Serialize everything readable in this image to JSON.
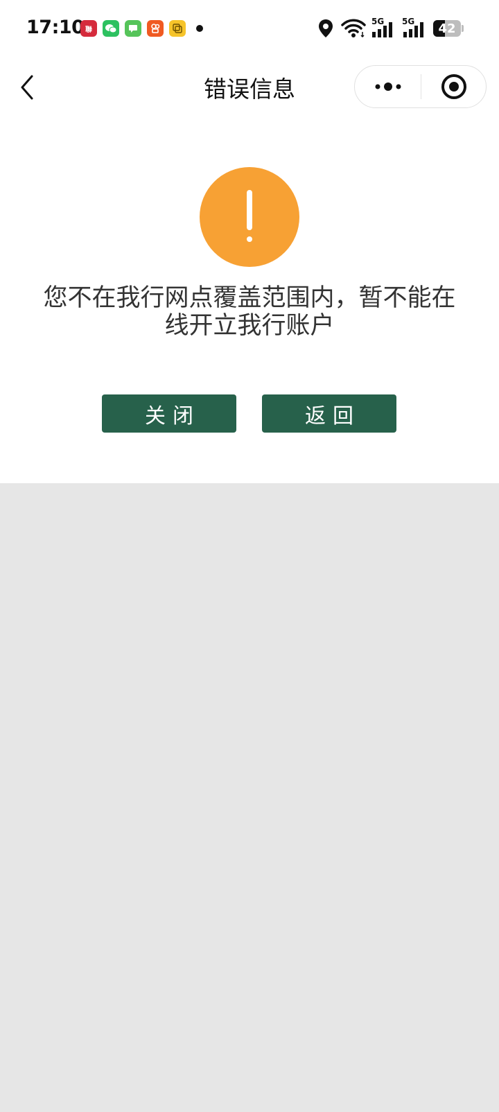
{
  "status_bar": {
    "time": "17:10",
    "network_1": "5G",
    "network_2": "5G",
    "battery_level": "42",
    "battery_fraction": 0.42,
    "app_icons": [
      {
        "name": "app-icon-1",
        "color": "#d52b3c",
        "text": "聯"
      },
      {
        "name": "app-icon-wechat",
        "color": "#2dc160",
        "text": ""
      },
      {
        "name": "app-icon-messages",
        "color": "#56c45a",
        "text": ""
      },
      {
        "name": "app-icon-4",
        "color": "#f05a22",
        "text": ""
      },
      {
        "name": "app-icon-5",
        "color": "#f6c42a",
        "text": ""
      }
    ]
  },
  "nav": {
    "title": "错误信息"
  },
  "content": {
    "icon": "warning-icon",
    "icon_color": "#f7a134",
    "message": "您不在我行网点覆盖范围内，暂不能在线开立我行账户"
  },
  "actions": {
    "close_label": "关闭",
    "back_label": "返回",
    "button_color": "#27614b"
  }
}
